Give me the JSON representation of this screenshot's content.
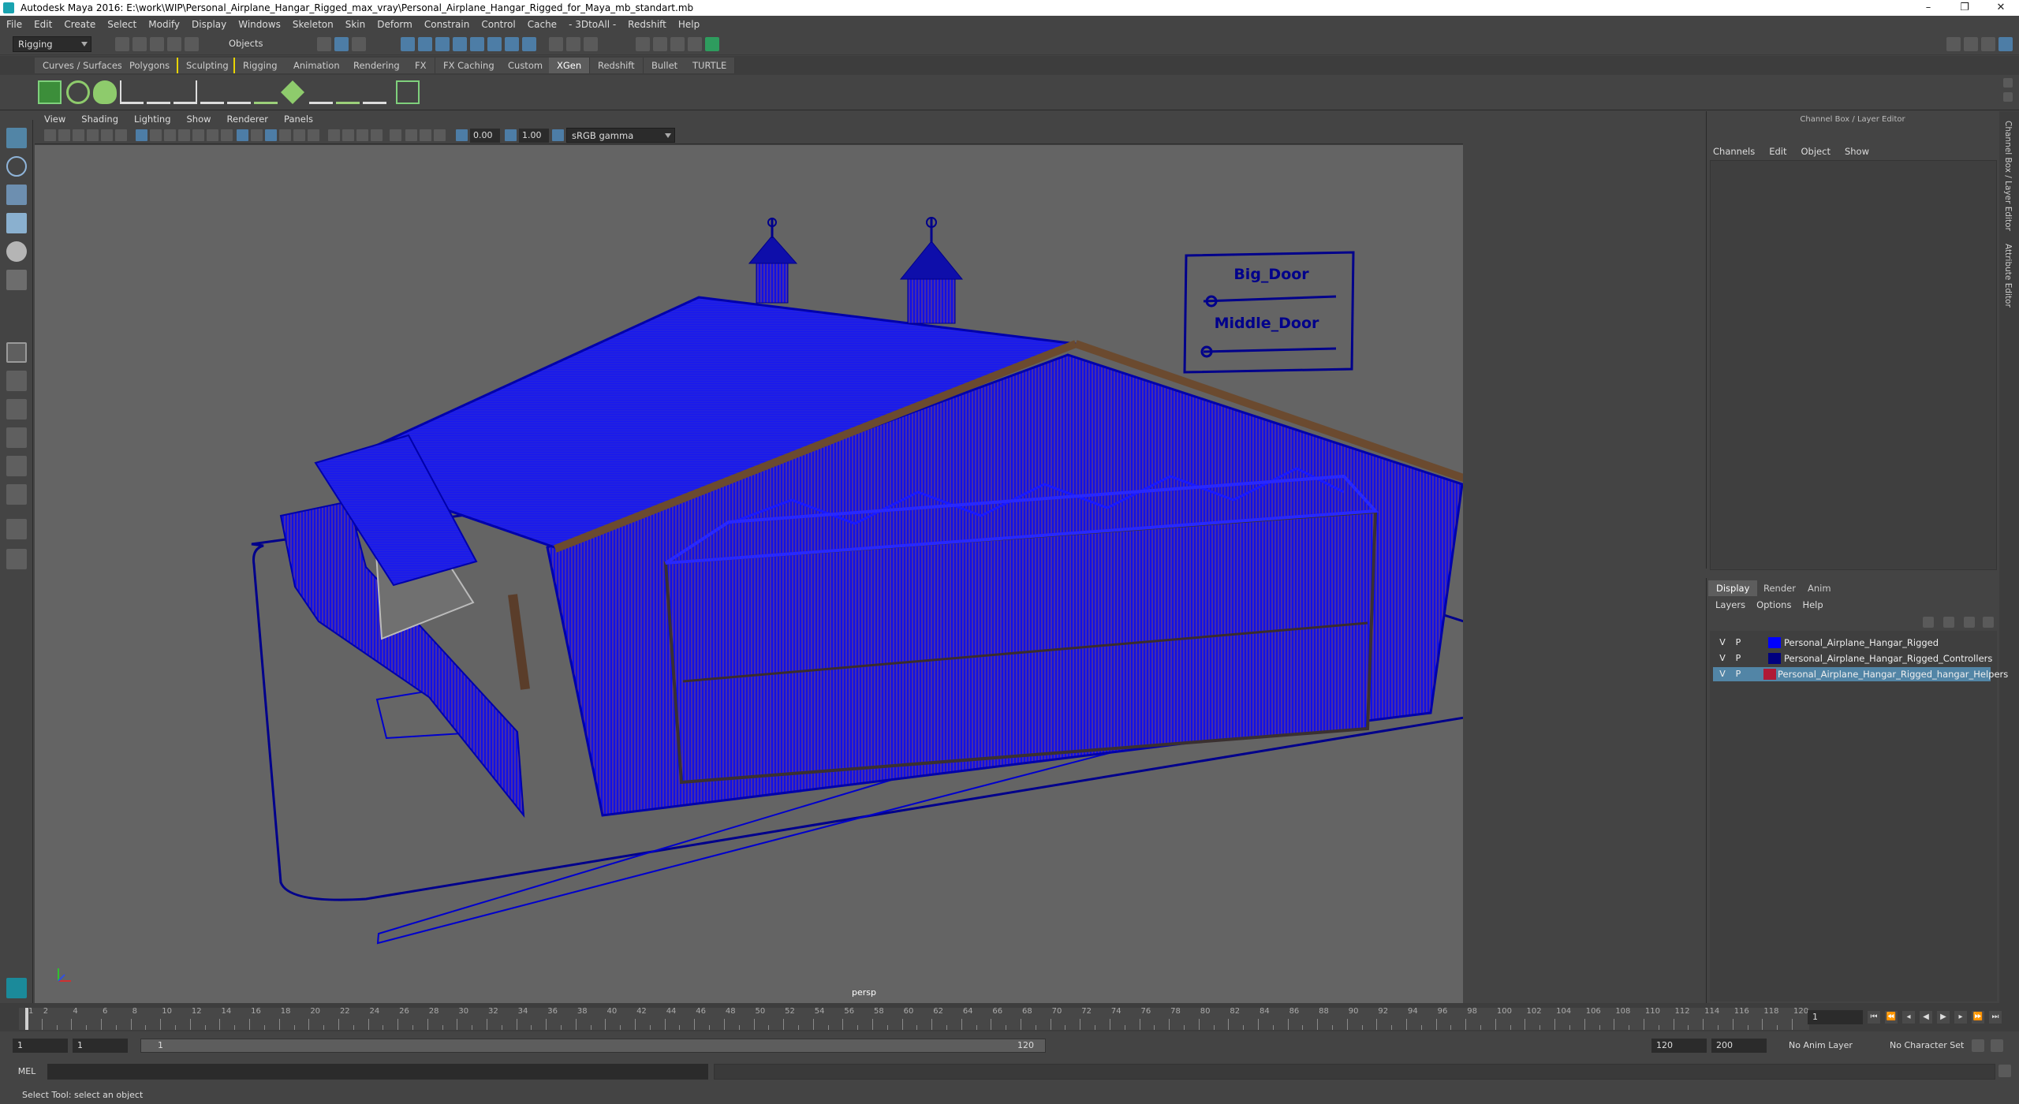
{
  "window": {
    "title": "Autodesk Maya 2016: E:\\work\\WIP\\Personal_Airplane_Hangar_Rigged_max_vray\\Personal_Airplane_Hangar_Rigged_for_Maya_mb_standart.mb",
    "controls": [
      "–",
      "❐",
      "✕"
    ]
  },
  "menubar": [
    "File",
    "Edit",
    "Create",
    "Select",
    "Modify",
    "Display",
    "Windows",
    "Skeleton",
    "Skin",
    "Deform",
    "Constrain",
    "Control",
    "Cache",
    "- 3DtoAll -",
    "Redshift",
    "Help"
  ],
  "statusline": {
    "mode": "Rigging",
    "selection_mask": "Objects"
  },
  "shelf_tabs": [
    "Curves / Surfaces",
    "Polygons",
    "Sculpting",
    "Rigging",
    "Animation",
    "Rendering",
    "FX",
    "FX Caching",
    "Custom",
    "XGen",
    "Redshift",
    "Bullet",
    "TURTLE"
  ],
  "active_shelf_tab": "XGen",
  "viewport": {
    "menu": [
      "View",
      "Shading",
      "Lighting",
      "Show",
      "Renderer",
      "Panels"
    ],
    "exposure": "0.00",
    "gamma": "1.00",
    "color_space": "sRGB gamma",
    "camera_label": "persp",
    "scene_labels": {
      "big_door": "Big_Door",
      "middle_door": "Middle_Door"
    }
  },
  "channel_box": {
    "title": "Channel Box / Layer Editor",
    "menu": [
      "Channels",
      "Edit",
      "Object",
      "Show"
    ]
  },
  "side_tabs": [
    "Channel Box / Layer Editor",
    "Attribute Editor"
  ],
  "layer_editor": {
    "tabs": [
      "Display",
      "Render",
      "Anim"
    ],
    "active_tab": "Display",
    "menu": [
      "Layers",
      "Options",
      "Help"
    ],
    "layers": [
      {
        "v": "V",
        "p": "P",
        "name": "Personal_Airplane_Hangar_Rigged",
        "color": "#0000ff"
      },
      {
        "v": "V",
        "p": "P",
        "name": "Personal_Airplane_Hangar_Rigged_Controllers",
        "color": "#000080"
      },
      {
        "v": "V",
        "p": "P",
        "name": "Personal_Airplane_Hangar_Rigged_hangar_Helpers",
        "color": "#b01a36"
      }
    ]
  },
  "timeline": {
    "ticks": [
      "1",
      "2",
      "4",
      "6",
      "8",
      "10",
      "12",
      "14",
      "16",
      "18",
      "20",
      "22",
      "24",
      "26",
      "28",
      "30",
      "32",
      "34",
      "36",
      "38",
      "40",
      "42",
      "44",
      "46",
      "48",
      "50",
      "52",
      "54",
      "56",
      "58",
      "60",
      "62",
      "64",
      "66",
      "68",
      "70",
      "72",
      "74",
      "76",
      "78",
      "80",
      "82",
      "84",
      "86",
      "88",
      "90",
      "92",
      "94",
      "96",
      "98",
      "100",
      "102",
      "104",
      "106",
      "108",
      "110",
      "112",
      "114",
      "116",
      "118",
      "120"
    ],
    "current_frame": "1"
  },
  "range": {
    "start": "1",
    "inner_start": "1",
    "slider_start": "1",
    "slider_end": "120",
    "end": "120",
    "anim_end": "200",
    "anim_layer": "No Anim Layer",
    "char_set": "No Character Set"
  },
  "command": {
    "label": "MEL"
  },
  "help_line": "Select Tool: select an object",
  "colors": {
    "wireframe": "#0000ff",
    "beam": "#6b4a2f",
    "accent": "#5285a6"
  }
}
